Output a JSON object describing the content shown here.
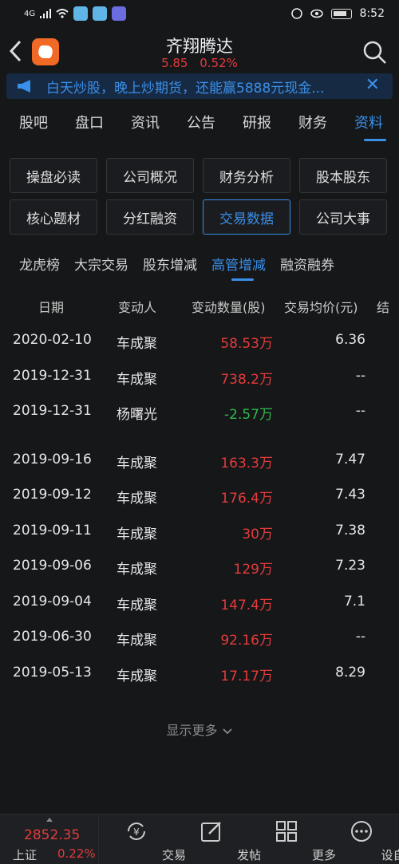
{
  "status_bar": {
    "network": "4G",
    "time": "8:52"
  },
  "header": {
    "title": "齐翔腾达",
    "price": "5.85",
    "change_pct": "0.52%"
  },
  "banner": {
    "text": "白天炒股，晚上炒期货，还能赢5888元现金..."
  },
  "main_tabs": [
    "股吧",
    "盘口",
    "资讯",
    "公告",
    "研报",
    "财务",
    "资料"
  ],
  "grid_buttons": [
    "操盘必读",
    "公司概况",
    "财务分析",
    "股本股东",
    "核心题材",
    "分红融资",
    "交易数据",
    "公司大事"
  ],
  "sub_tabs": [
    "龙虎榜",
    "大宗交易",
    "股东增减",
    "高管增减",
    "融资融券"
  ],
  "table": {
    "headers": [
      "日期",
      "变动人",
      "变动数量(股)",
      "交易均价(元)",
      "结"
    ],
    "rows": [
      {
        "date": "2020-02-10",
        "person": "车成聚",
        "qty": "58.53万",
        "price": "6.36"
      },
      {
        "date": "2019-12-31",
        "person": "车成聚",
        "qty": "738.2万",
        "price": "--"
      },
      {
        "date": "2019-12-31",
        "person": "杨曙光",
        "qty": "-2.57万",
        "price": "--"
      },
      {
        "date": "2019-09-16",
        "person": "车成聚",
        "qty": "163.3万",
        "price": "7.47"
      },
      {
        "date": "2019-09-12",
        "person": "车成聚",
        "qty": "176.4万",
        "price": "7.43"
      },
      {
        "date": "2019-09-11",
        "person": "车成聚",
        "qty": "30万",
        "price": "7.38"
      },
      {
        "date": "2019-09-06",
        "person": "车成聚",
        "qty": "129万",
        "price": "7.23"
      },
      {
        "date": "2019-09-04",
        "person": "车成聚",
        "qty": "147.4万",
        "price": "7.1"
      },
      {
        "date": "2019-06-30",
        "person": "车成聚",
        "qty": "92.16万",
        "price": "--"
      },
      {
        "date": "2019-05-13",
        "person": "车成聚",
        "qty": "17.17万",
        "price": "8.29"
      }
    ]
  },
  "more_label": "显示更多",
  "bottom_bar": {
    "index_value": "2852.35",
    "index_name": "上证",
    "index_pct": "0.22%",
    "items": [
      "交易",
      "发帖",
      "更多",
      "设自选"
    ]
  },
  "colors": {
    "up": "#e43b3b",
    "down": "#2fb84d",
    "accent": "#3a8fe8"
  }
}
